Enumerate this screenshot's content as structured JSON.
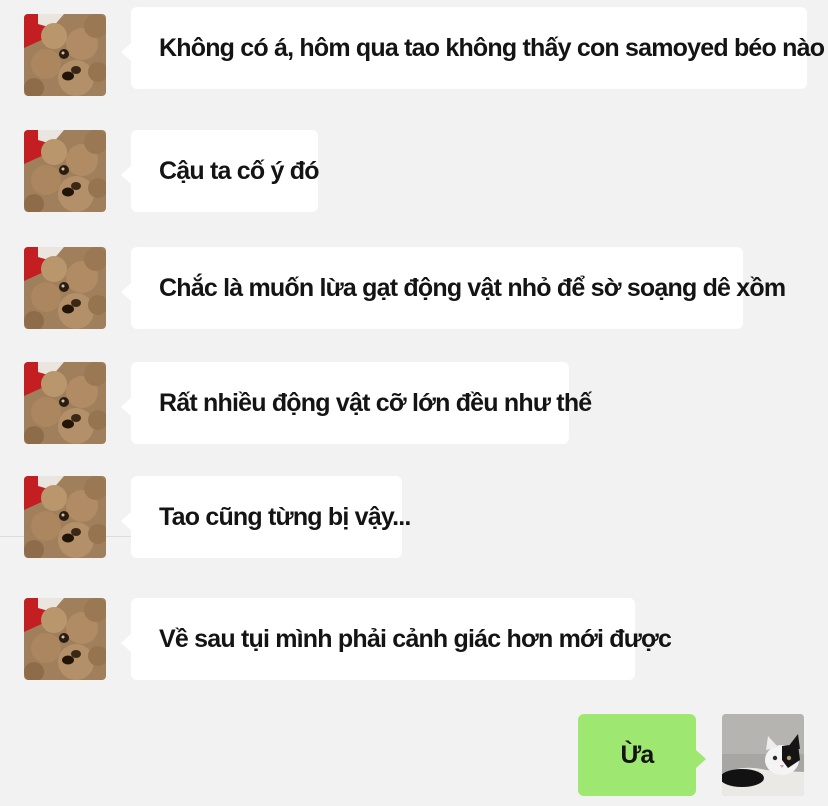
{
  "chat": {
    "messages": [
      {
        "sender": "other",
        "text": "Không có á, hôm qua tao không thấy con samoyed béo nào cả"
      },
      {
        "sender": "other",
        "text": "Cậu ta cố ý đó"
      },
      {
        "sender": "other",
        "text": "Chắc là muốn lừa gạt động vật nhỏ để sờ soạng dê xồm"
      },
      {
        "sender": "other",
        "text": "Rất nhiều động vật cỡ lớn đều như thế"
      },
      {
        "sender": "other",
        "text": "Tao cũng từng bị vậy..."
      },
      {
        "sender": "other",
        "text": "Về sau tụi mình phải cảnh giác hơn mới được"
      },
      {
        "sender": "me",
        "text": "Ừa"
      }
    ]
  },
  "avatars": {
    "other": "poodle-avatar-icon",
    "me": "cat-avatar-icon"
  },
  "colors": {
    "background": "#f2f2f2",
    "incoming_bubble": "#ffffff",
    "outgoing_bubble": "#9ee871",
    "text": "#141414"
  }
}
